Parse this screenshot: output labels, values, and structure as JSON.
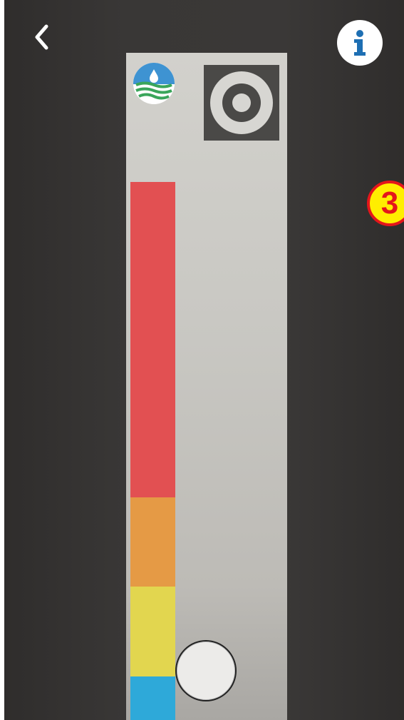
{
  "toolbar": {
    "back_icon": "chevron-left-icon",
    "info_icon": "info-icon"
  },
  "test_strip": {
    "logo_icon": "water-logo-icon",
    "target_icon": "ring-target-icon",
    "color_scale": [
      {
        "name": "red",
        "color": "#e25052"
      },
      {
        "name": "orange",
        "color": "#e59a45"
      },
      {
        "name": "yellow",
        "color": "#e2d64f"
      },
      {
        "name": "blue",
        "color": "#2ea9d9"
      }
    ]
  },
  "step_badge": {
    "label": "3",
    "fill": "#ffee00",
    "border": "#e4161b"
  },
  "colors": {
    "background": "#3a3837",
    "strip": "#c9c8c3",
    "info_accent": "#1e6fb3"
  }
}
